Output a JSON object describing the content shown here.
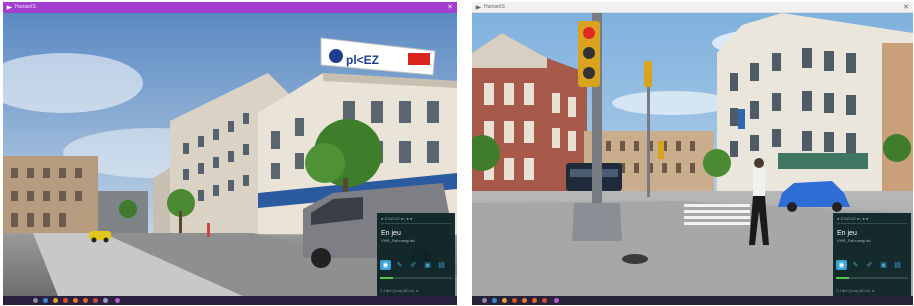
{
  "windows": [
    {
      "title": "HumanIS",
      "close_glyph": "✕",
      "theme_color": "#a23ed0",
      "billboard_text": "pl<EZ",
      "overlay": {
        "header": "● STATUS ● | ● ●",
        "status": "En jeu",
        "file": "VHR_Fabr.wegl.ab",
        "tools": [
          "camera-icon",
          "pen-icon",
          "brush-icon",
          "save-icon",
          "doc-icon"
        ],
        "progress": 0.18,
        "footer": "© 2 ■ 4  (3 ms) (60 hz) ◄"
      }
    },
    {
      "title": "HumanIS",
      "close_glyph": "✕",
      "theme_color": "#f1f1f1",
      "overlay": {
        "header": "● STATUS ● | ● ●",
        "status": "En jeu",
        "file": "VHR_Fabr.wegl.ab",
        "tools": [
          "camera-icon",
          "pen-icon",
          "brush-icon",
          "save-icon",
          "doc-icon"
        ],
        "progress": 0.18,
        "footer": "© 2 ■ 4  (3 ms) (60 hz) ◄"
      }
    }
  ]
}
